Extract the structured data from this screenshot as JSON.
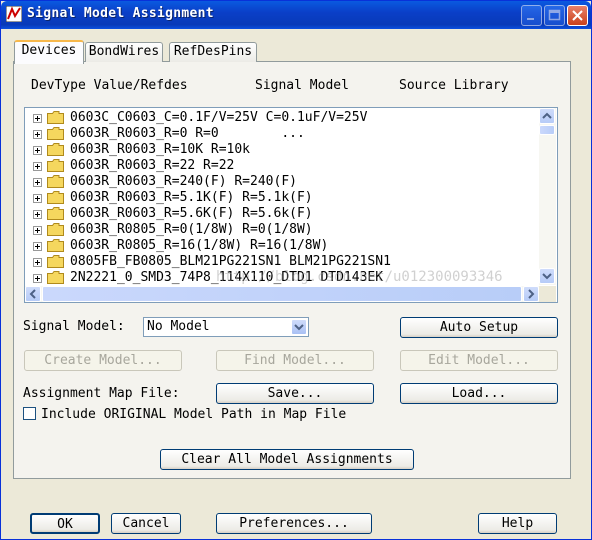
{
  "window": {
    "title": "Signal Model Assignment"
  },
  "tabs": [
    {
      "label": "Devices",
      "active": true
    },
    {
      "label": "BondWires",
      "active": false
    },
    {
      "label": "RefDesPins",
      "active": false
    }
  ],
  "columns": {
    "devtype": "DevType Value/Refdes",
    "signal_model": "Signal Model",
    "source_library": "Source Library"
  },
  "tree_rows": [
    "0603C_C0603_C=0.1F/V=25V C=0.1uF/V=25V",
    "0603R_R0603_R=0 R=0        ...",
    "0603R_R0603_R=10K R=10k",
    "0603R_R0603_R=22 R=22",
    "0603R_R0603_R=240(F) R=240(F)",
    "0603R_R0603_R=5.1K(F) R=5.1k(F)",
    "0603R_R0603_R=5.6K(F) R=5.6k(F)",
    "0603R_R0805_R=0(1/8W) R=0(1/8W)",
    "0603R_R0805_R=16(1/8W) R=16(1/8W)",
    "0805FB_FB0805_BLM21PG221SN1 BLM21PG221SN1",
    "2N2221_0_SMD3_74P8_114X110_DTD1 DTD143EK"
  ],
  "watermark": "http://blog.csdn.net/u012300093346",
  "signal_model": {
    "label": "Signal Model:",
    "value": "No Model"
  },
  "buttons": {
    "auto_setup": "Auto Setup",
    "create_model": "Create Model...",
    "find_model": "Find Model...",
    "edit_model": "Edit Model...",
    "save": "Save...",
    "load": "Load...",
    "clear_all": "Clear All Model Assignments",
    "ok": "OK",
    "cancel": "Cancel",
    "preferences": "Preferences...",
    "help": "Help"
  },
  "assignment_map_label": "Assignment Map File:",
  "include_original": {
    "label": "Include ORIGINAL Model Path in Map File",
    "checked": false
  },
  "colors": {
    "titlebar": "#0a3fc8",
    "folder": "#f5d75e",
    "tab_highlight": "#f7b84b"
  }
}
